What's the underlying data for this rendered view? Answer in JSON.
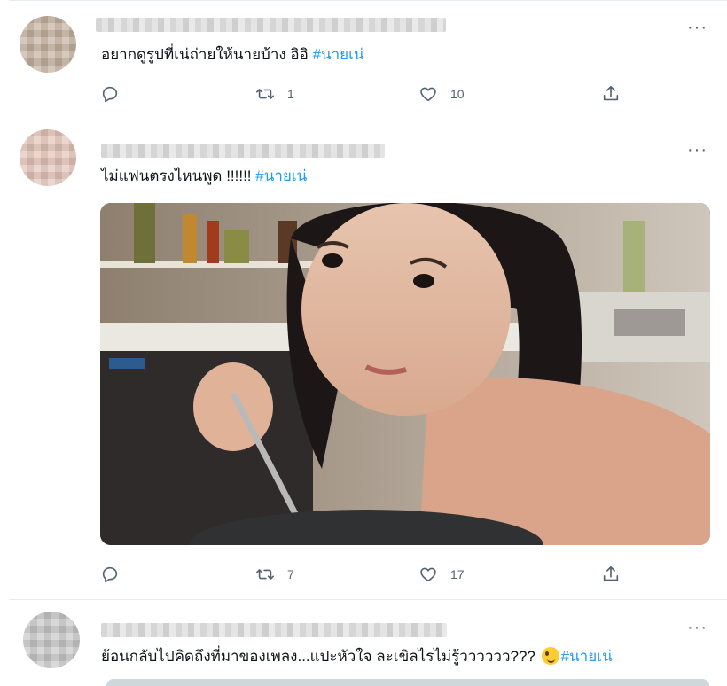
{
  "tweets": [
    {
      "text": "อยากดูรูปที่เน่ถ่ายให้นายบ้าง อิอิ ",
      "hashtag": "#นายเน่",
      "more": "···",
      "retweets": "1",
      "likes": "10"
    },
    {
      "text": "ไม่แฟนตรงไหนพูด !!!!!! ",
      "hashtag": "#นายเน่",
      "more": "···",
      "retweets": "7",
      "likes": "17",
      "photo_icon": "photo"
    },
    {
      "text": "ย้อนกลับไปคิดถึงที่มาของเพลง...แปะหัวใจ ละเขิลไรไม่รู้วววววว???",
      "emoji": "zany-face-emoji",
      "hashtag": "#นายเน่",
      "more": "···"
    }
  ],
  "colors": {
    "hashtag": "#1d9bf0",
    "icon": "#536471",
    "border": "#e6ecf0"
  }
}
